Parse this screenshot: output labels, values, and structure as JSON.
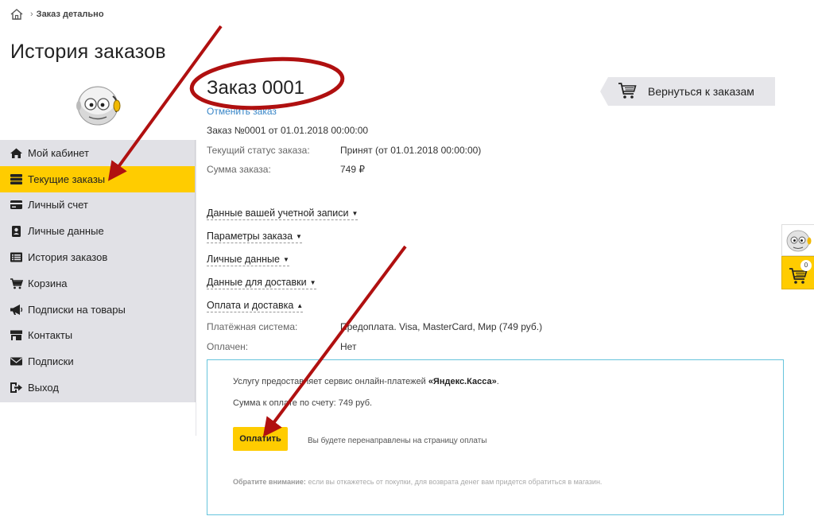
{
  "breadcrumb": {
    "current": "Заказ детально",
    "separator": "›"
  },
  "page_title": "История заказов",
  "sidebar": {
    "items": [
      {
        "label": "Мой кабинет",
        "icon": "home-icon",
        "active": false
      },
      {
        "label": "Текущие заказы",
        "icon": "server-icon",
        "active": true
      },
      {
        "label": "Личный счет",
        "icon": "credit-card-icon",
        "active": false
      },
      {
        "label": "Личные данные",
        "icon": "id-badge-icon",
        "active": false
      },
      {
        "label": "История заказов",
        "icon": "list-icon",
        "active": false
      },
      {
        "label": "Корзина",
        "icon": "cart-icon",
        "active": false
      },
      {
        "label": "Подписки на товары",
        "icon": "megaphone-icon",
        "active": false
      },
      {
        "label": "Контакты",
        "icon": "store-icon",
        "active": false
      },
      {
        "label": "Подписки",
        "icon": "envelope-icon",
        "active": false
      },
      {
        "label": "Выход",
        "icon": "sign-out-icon",
        "active": false
      }
    ]
  },
  "order": {
    "title": "Заказ 0001",
    "cancel_link": "Отменить заказ",
    "number_line": "Заказ №0001 от 01.01.2018 00:00:00",
    "status_label": "Текущий статус заказа:",
    "status_value": "Принят (от 01.01.2018 00:00:00)",
    "sum_label": "Сумма заказа:",
    "sum_value": "749 ₽"
  },
  "back_button": {
    "label": "Вернуться к заказам"
  },
  "sections": [
    {
      "label": "Данные вашей учетной записи",
      "expanded": false
    },
    {
      "label": "Параметры заказа",
      "expanded": false
    },
    {
      "label": "Личные данные",
      "expanded": false
    },
    {
      "label": "Данные для доставки",
      "expanded": false
    },
    {
      "label": "Оплата и доставка",
      "expanded": true
    }
  ],
  "payment": {
    "system_label": "Платёжная система:",
    "system_value": "Предоплата. Visa, MasterCard, Мир (749 руб.)",
    "paid_label": "Оплачен:",
    "paid_value": "Нет"
  },
  "paybox": {
    "service_text": "Услугу предоставляет сервис онлайн-платежей ",
    "service_name": "«Яндекс.Касса»",
    "service_end": ".",
    "sum_text": "Сумма к оплате по счету: 749 руб.",
    "pay_button": "Оплатить",
    "redirect_note": "Вы будете перенаправлены на страницу оплаты",
    "notice_bold": "Обратите внимание:",
    "notice_text": " если вы откажетесь от покупки, для возврата денег вам придется обратиться в магазин."
  },
  "float_widget": {
    "cart_count": "0"
  },
  "colors": {
    "accent": "#ffcc00",
    "link": "#3a87c8",
    "annotation": "#b01010",
    "paybox_border": "#66c4dc"
  }
}
